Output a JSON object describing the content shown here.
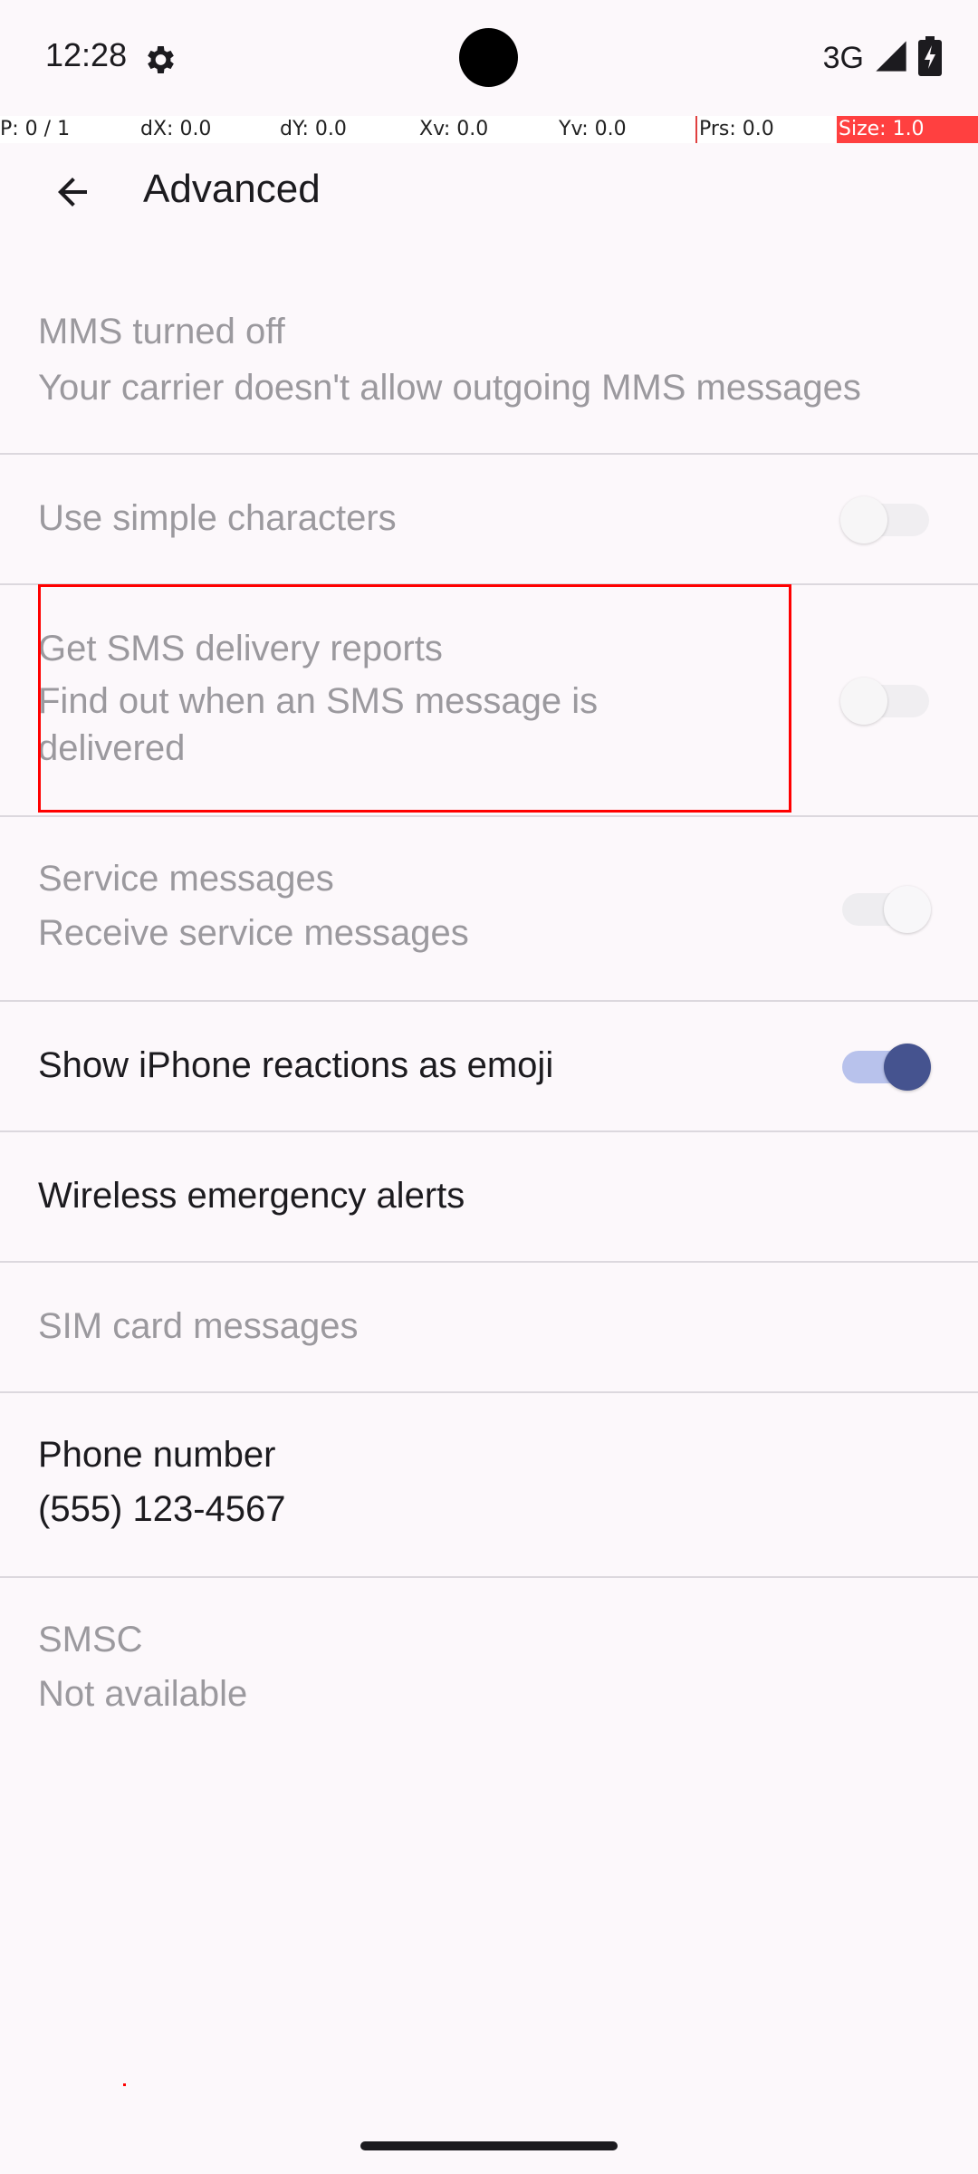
{
  "status_bar": {
    "time": "12:28",
    "network_type": "3G"
  },
  "pointer_info": {
    "p": "P: 0 / 1",
    "dx": "dX: 0.0",
    "dy": "dY: 0.0",
    "xv": "Xv: 0.0",
    "yv": "Yv: 0.0",
    "prs": "Prs: 0.0",
    "size": "Size: 1.0"
  },
  "app_bar": {
    "title": "Advanced"
  },
  "settings": {
    "mms": {
      "title": "MMS turned off",
      "summary": "Your carrier doesn't allow outgoing MMS messages"
    },
    "simple_chars": {
      "title": "Use simple characters"
    },
    "sms_reports": {
      "title": "Get SMS delivery reports",
      "summary": "Find out when an SMS message is delivered"
    },
    "service_messages": {
      "title": "Service messages",
      "summary": "Receive service messages"
    },
    "iphone_reactions": {
      "title": "Show iPhone reactions as emoji"
    },
    "emergency_alerts": {
      "title": "Wireless emergency alerts"
    },
    "sim_messages": {
      "title": "SIM card messages"
    },
    "phone_number": {
      "title": "Phone number",
      "summary": "(555) 123-4567"
    },
    "smsc": {
      "title": "SMSC",
      "summary": "Not available"
    }
  },
  "colors": {
    "background": "#fcf8fb",
    "accent": "#45538f",
    "highlight": "#ff0000"
  }
}
